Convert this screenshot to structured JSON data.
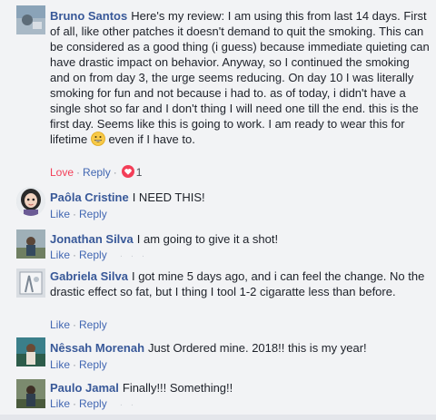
{
  "comments": [
    {
      "author": "Bruno Santos",
      "text": "Here's my review: I am using this from last 14 days. First of all, like other patches it doesn't demand to quit the smoking. This can be considered as a good thing (i guess) because immediate quieting can have drastic impact on behavior. Anyway, so I continued the smoking and on from day 3, the urge seems reducing. On day 10 I was literally smoking for fun and not because i had to. as of today, i didn't have a single shot so far and I don't thing I will need one till the end. this is the first day. Seems like this is going to work. I am ready to wear this for lifetime",
      "text_end": "even if I have to.",
      "action_love": "Love",
      "action_reply": "Reply",
      "reaction_count": "1",
      "reaction_icon": "heart-icon",
      "emoji_icon": "grinning-face-icon"
    },
    {
      "author": "Paôla Cristine",
      "text": "I NEED THIS!",
      "action_like": "Like",
      "action_reply": "Reply"
    },
    {
      "author": "Jonathan Silva",
      "text": "I am going to give it a shot!",
      "action_like": "Like",
      "action_reply": "Reply"
    },
    {
      "author": "Gabriela Silva",
      "text": "I got mine 5 days ago, and i can feel the change. No the drastic effect so fat, but I thing I tool 1-2 cigaratte less than before.",
      "action_like": "Like",
      "action_reply": "Reply"
    },
    {
      "author": "Nêssah Morenah",
      "text": "Just Ordered mine. 2018!! this is my year!",
      "action_like": "Like",
      "action_reply": "Reply"
    },
    {
      "author": "Paulo Jamal",
      "text": "Finally!!! Something!!",
      "action_like": "Like",
      "action_reply": "Reply"
    }
  ],
  "colors": {
    "author": "#385898",
    "action": "#4267b2",
    "love": "#f33e58",
    "background": "#f2f3f5"
  }
}
